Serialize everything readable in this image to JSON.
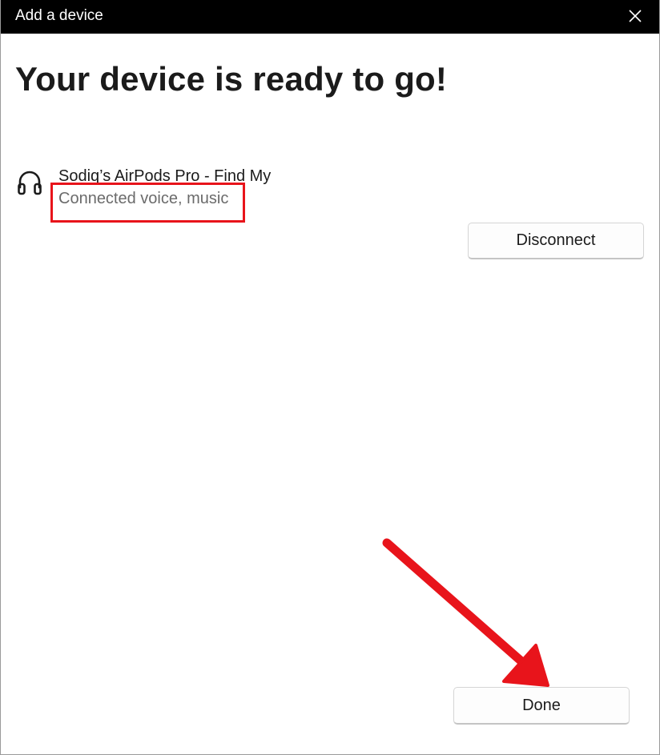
{
  "window": {
    "title": "Add a device",
    "close_icon": "close-icon"
  },
  "main": {
    "heading": "Your device is ready to go!",
    "device": {
      "icon": "headphones-icon",
      "name": "Sodiq’s AirPods Pro - Find My",
      "status": "Connected voice, music"
    },
    "disconnect_label": "Disconnect",
    "done_label": "Done"
  },
  "colors": {
    "titlebar": "#000000",
    "annotation_red": "#e8141b"
  }
}
